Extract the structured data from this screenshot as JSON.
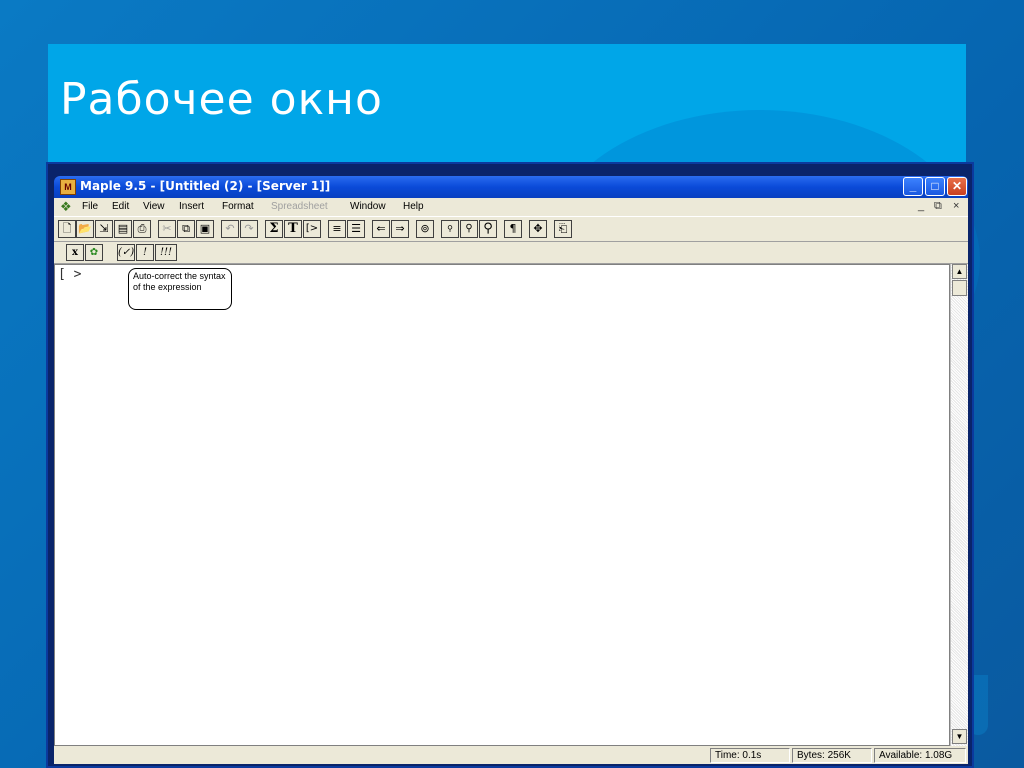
{
  "slide": {
    "title": "Рабочее окно"
  },
  "window": {
    "title": "Maple 9.5  - [Untitled (2) - [Server 1]]",
    "app_icon": "maple-leaf-icon",
    "caption_buttons": [
      "minimize",
      "maximize",
      "close"
    ]
  },
  "menubar": {
    "items": [
      {
        "label": "File",
        "enabled": true
      },
      {
        "label": "Edit",
        "enabled": true
      },
      {
        "label": "View",
        "enabled": true
      },
      {
        "label": "Insert",
        "enabled": true
      },
      {
        "label": "Format",
        "enabled": true
      },
      {
        "label": "Spreadsheet",
        "enabled": false
      },
      {
        "label": "Window",
        "enabled": true
      },
      {
        "label": "Help",
        "enabled": true
      }
    ],
    "mdi": {
      "minimize": "_",
      "restore": "⧉",
      "close": "×"
    }
  },
  "toolbar": {
    "buttons": [
      "new-icon",
      "open-icon",
      "open-url-icon",
      "save-icon",
      "print-icon",
      "cut-icon",
      "copy-icon",
      "paste-icon",
      "undo-icon",
      "redo-icon",
      "math-input-icon",
      "text-input-icon",
      "prompt-icon",
      "indent-icon",
      "outdent-icon",
      "back-icon",
      "forward-icon",
      "stop-icon",
      "zoom-small-icon",
      "zoom-medium-icon",
      "zoom-large-icon",
      "pilcrow-icon",
      "expand-icon",
      "restart-icon"
    ],
    "glyphs": {
      "sigma": "Σ",
      "text": "T",
      "prompt": "[>",
      "pilcrow": "¶"
    }
  },
  "context_toolbar": {
    "glyphs": {
      "x": "x",
      "check": "(✓)",
      "exec": "!",
      "exec_all": "!!!"
    }
  },
  "worksheet": {
    "prompt": "[ >",
    "tooltip": "Auto-correct the syntax of the expression"
  },
  "statusbar": {
    "time": "Time:  0.1s",
    "bytes": "Bytes:  256K",
    "available": "Available: 1.08G"
  }
}
